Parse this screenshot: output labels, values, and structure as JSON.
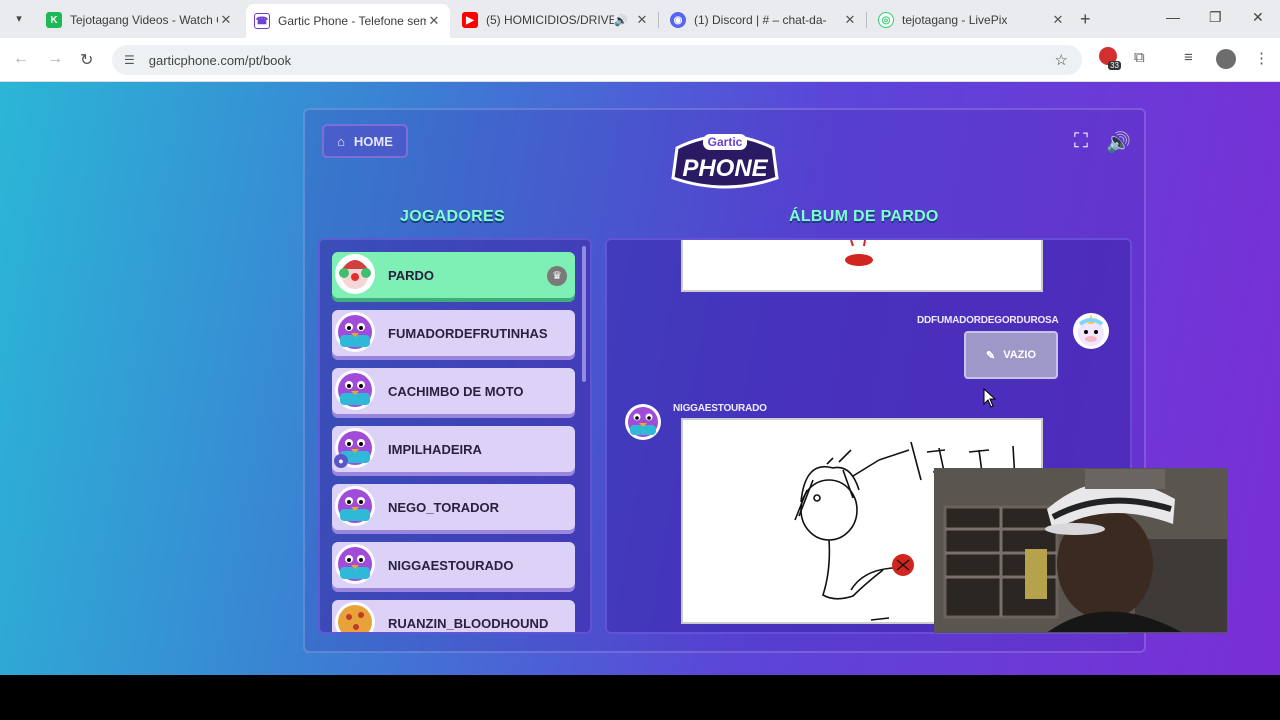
{
  "browser": {
    "tabs": [
      {
        "title": "Tejotagang Videos - Watch C",
        "favicon": "K",
        "fav_color": "#1db954"
      },
      {
        "title": "Gartic Phone - Telefone sem",
        "favicon": "phone-icon",
        "fav_color": "#6b3fd6",
        "active": true
      },
      {
        "title": "(5) HOMICIDIOS/DRIVE",
        "favicon": "youtube-icon",
        "fav_color": "#ff0000",
        "audio": true
      },
      {
        "title": "(1) Discord | #",
        "extra": "– chat-da-",
        "favicon": "discord-icon",
        "fav_color": "#5865f2"
      },
      {
        "title": "tejotagang - LivePix",
        "favicon": "livepix-icon",
        "fav_color": "#2ecc71"
      }
    ],
    "url": "garticphone.com/pt/book",
    "extension_badge": "33"
  },
  "game": {
    "home_label": "HOME",
    "logo_top": "Gartic",
    "logo_bottom": "PHONE",
    "players_title": "JOGADORES",
    "album_title": "ÁLBUM DE PARDO",
    "players": [
      {
        "name": "PARDO",
        "host": true
      },
      {
        "name": "FUMADORDEFRUTINHAS"
      },
      {
        "name": "CACHIMBO DE MOTO"
      },
      {
        "name": "IMPILHADEIRA"
      },
      {
        "name": "NEGO_TORADOR"
      },
      {
        "name": "NIGGAESTOURADO"
      },
      {
        "name": "RUANZIN_BLOODHOUND"
      }
    ],
    "album": {
      "entry1_user": "DDFUMADORDEGORDUROSA",
      "entry1_text": "VAZIO",
      "entry2_user": "NIGGAESTOURADO"
    }
  },
  "colors": {
    "accent": "#7dffcf",
    "host_row": "#7ff0b5",
    "player_row": "#dcd2f7"
  }
}
